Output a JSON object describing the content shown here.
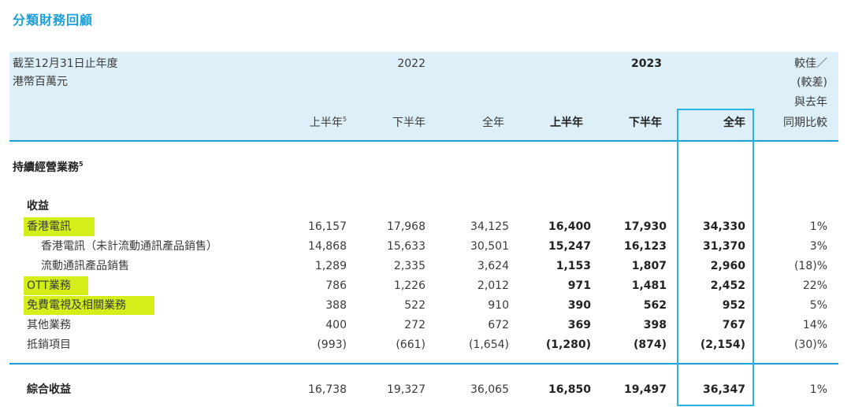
{
  "title": "分類財務回顧",
  "header": {
    "period_label_1": "截至12月31日止年度",
    "period_label_2": "港幣百萬元",
    "year_2022": "2022",
    "year_2023": "2023",
    "change_1": "較佳／",
    "change_2": "(較差)",
    "change_3": "與去年",
    "change_4": "同期比較",
    "col_h1_2022": "上半年",
    "col_h1_2022_sup": "5",
    "col_h2_2022": "下半年",
    "col_fy_2022": "全年",
    "col_h1_2023": "上半年",
    "col_h2_2023": "下半年",
    "col_fy_2023": "全年"
  },
  "section": {
    "label": "持續經營業務",
    "sup": "5"
  },
  "revenue_label": "收益",
  "rows": [
    {
      "label": "香港電訊",
      "v": [
        "16,157",
        "17,968",
        "34,125",
        "16,400",
        "17,930",
        "34,330",
        "1%"
      ]
    },
    {
      "label": "香港電訊（未計流動通訊產品銷售）",
      "v": [
        "14,868",
        "15,633",
        "30,501",
        "15,247",
        "16,123",
        "31,370",
        "3%"
      ]
    },
    {
      "label": "流動通訊產品銷售",
      "v": [
        "1,289",
        "2,335",
        "3,624",
        "1,153",
        "1,807",
        "2,960",
        "(18)%"
      ]
    },
    {
      "label": "OTT業務",
      "v": [
        "786",
        "1,226",
        "2,012",
        "971",
        "1,481",
        "2,452",
        "22%"
      ]
    },
    {
      "label": "免費電視及相關業務",
      "v": [
        "388",
        "522",
        "910",
        "390",
        "562",
        "952",
        "5%"
      ]
    },
    {
      "label": "其他業務",
      "v": [
        "400",
        "272",
        "672",
        "369",
        "398",
        "767",
        "14%"
      ]
    },
    {
      "label": "抵銷項目",
      "v": [
        "(993)",
        "(661)",
        "(1,654)",
        "(1,280)",
        "(874)",
        "(2,154)",
        "(30)%"
      ]
    }
  ],
  "total": {
    "label": "綜合收益",
    "v": [
      "16,738",
      "19,327",
      "36,065",
      "16,850",
      "19,497",
      "36,347",
      "1%"
    ]
  },
  "highlight_color": "#d3ee19",
  "accent_color": "#1a9fd8"
}
